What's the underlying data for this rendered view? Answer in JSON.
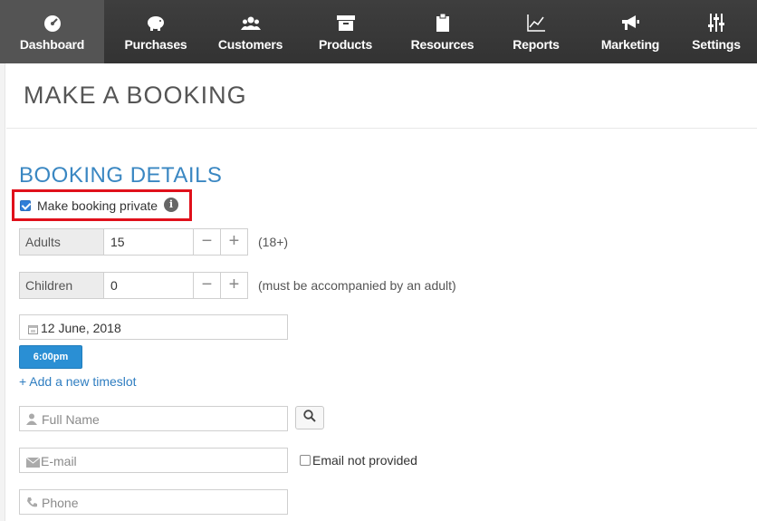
{
  "nav": {
    "items": [
      {
        "label": "Dashboard",
        "icon": "dashboard-icon"
      },
      {
        "label": "Purchases",
        "icon": "piggy-bank-icon"
      },
      {
        "label": "Customers",
        "icon": "users-icon"
      },
      {
        "label": "Products",
        "icon": "box-icon"
      },
      {
        "label": "Resources",
        "icon": "clipboard-icon"
      },
      {
        "label": "Reports",
        "icon": "line-chart-icon"
      },
      {
        "label": "Marketing",
        "icon": "megaphone-icon"
      },
      {
        "label": "Settings",
        "icon": "sliders-icon"
      }
    ],
    "active": "Dashboard"
  },
  "page": {
    "title": "MAKE A BOOKING"
  },
  "booking": {
    "section_title": "BOOKING DETAILS",
    "private_label": "Make booking private",
    "private_checked": true,
    "info_glyph": "i",
    "adults": {
      "label": "Adults",
      "value": "15",
      "hint": "(18+)"
    },
    "children": {
      "label": "Children",
      "value": "0",
      "hint": "(must be accompanied by an adult)"
    },
    "minus": "−",
    "plus": "+",
    "date": "12 June, 2018",
    "timeslot": "6:00pm",
    "add_timeslot": "+ Add a new timeslot",
    "full_name_placeholder": "Full Name",
    "email_placeholder": "E-mail",
    "email_not_provided": "Email not provided",
    "phone_placeholder": "Phone"
  },
  "colors": {
    "accent": "#2a8fd4",
    "title_blue": "#3a87c2",
    "highlight_red": "#e0101b",
    "nav_bg": "#3a3a3a"
  }
}
